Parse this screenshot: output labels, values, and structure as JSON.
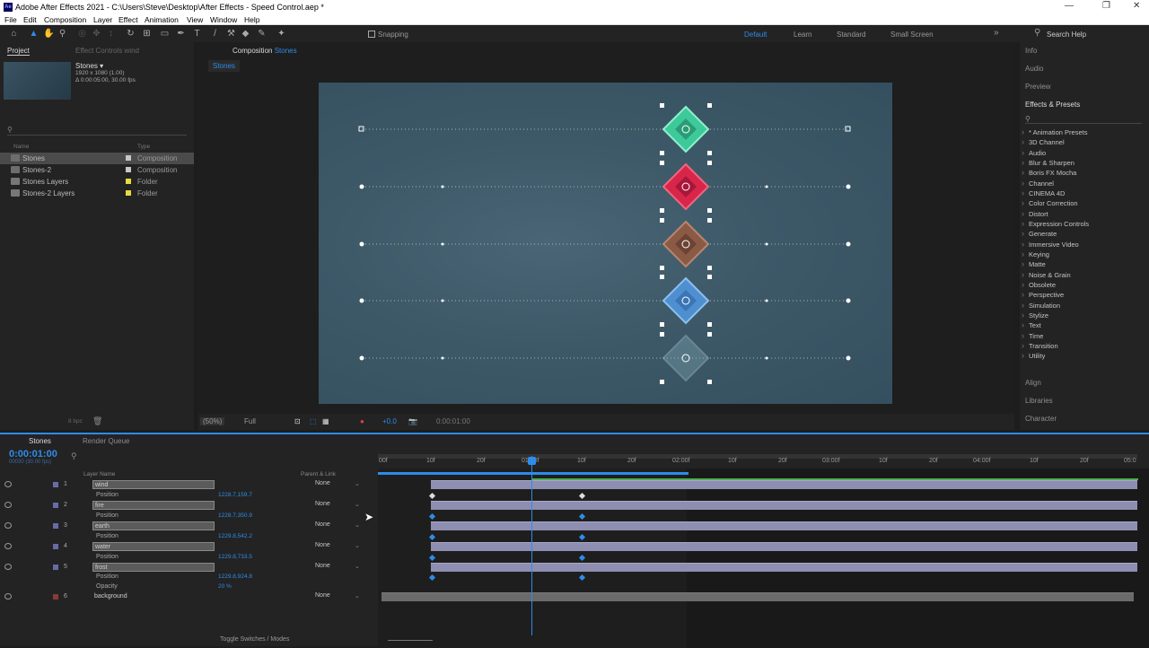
{
  "window": {
    "title": "Adobe After Effects 2021 - C:\\Users\\Steve\\Desktop\\After Effects - Speed Control.aep *",
    "logo": "Ae"
  },
  "menu": [
    "File",
    "Edit",
    "Composition",
    "Layer",
    "Effect",
    "Animation",
    "View",
    "Window",
    "Help"
  ],
  "toolbar": {
    "snapping": "Snapping",
    "workspaces": [
      "Default",
      "Learn",
      "Standard",
      "Small Screen"
    ],
    "search": "Search Help"
  },
  "project": {
    "tab": "Project",
    "effect_controls": "Effect Controls wind",
    "comp_name": "Stones ▾",
    "comp_info1": "1920 x 1080 (1.00)",
    "comp_info2": "Δ 0:00:05:00, 30.00 fps",
    "col_name": "Name",
    "col_type": "Type",
    "items": [
      {
        "name": "Stones",
        "type": "Composition",
        "color": "#c8c8c8"
      },
      {
        "name": "Stones-2",
        "type": "Composition",
        "color": "#c8c8c8"
      },
      {
        "name": "Stones Layers",
        "type": "Folder",
        "color": "#e6dc3c"
      },
      {
        "name": "Stones-2 Layers",
        "type": "Folder",
        "color": "#e6dc3c"
      }
    ],
    "bpc": "8 bpc"
  },
  "composition": {
    "tab_prefix": "Composition",
    "tab_name": "Stones",
    "sub_tab": "Stones",
    "zoom": "(50%)",
    "quality": "Full",
    "exposure": "+0.0",
    "time": "0:00:01:00"
  },
  "right": {
    "info": "Info",
    "audio": "Audio",
    "preview": "Preview",
    "effects_presets": "Effects & Presets",
    "effects": [
      "* Animation Presets",
      "3D Channel",
      "Audio",
      "Blur & Sharpen",
      "Boris FX Mocha",
      "Channel",
      "CINEMA 4D",
      "Color Correction",
      "Distort",
      "Expression Controls",
      "Generate",
      "Immersive Video",
      "Keying",
      "Matte",
      "Noise & Grain",
      "Obsolete",
      "Perspective",
      "Simulation",
      "Stylize",
      "Text",
      "Time",
      "Transition",
      "Utility"
    ],
    "align": "Align",
    "libraries": "Libraries",
    "character": "Character"
  },
  "timeline": {
    "tab": "Stones",
    "render_queue": "Render Queue",
    "timecode": "0:00:01:00",
    "frames": "00030 (30.00 fps)",
    "col_layer": "Layer Name",
    "col_parent": "Parent & Link",
    "toggle": "Toggle Switches / Modes",
    "ruler": [
      "00f",
      "10f",
      "20f",
      "01:00f",
      "10f",
      "20f",
      "02:00f",
      "10f",
      "20f",
      "03:00f",
      "10f",
      "20f",
      "04:00f",
      "10f",
      "20f",
      "05:0"
    ],
    "layers": [
      {
        "num": "1",
        "name": "wind",
        "parent": "None",
        "prop": "Position",
        "val": "1228.7,159.7"
      },
      {
        "num": "2",
        "name": "fire",
        "parent": "None",
        "prop": "Position",
        "val": "1228.7,350.9"
      },
      {
        "num": "3",
        "name": "earth",
        "parent": "None",
        "prop": "Position",
        "val": "1229.8,542.2"
      },
      {
        "num": "4",
        "name": "water",
        "parent": "None",
        "prop": "Position",
        "val": "1229.8,733.5"
      },
      {
        "num": "5",
        "name": "frost",
        "parent": "None",
        "prop": "Position",
        "val": "1229.8,924.8",
        "prop2": "Opacity",
        "val2": "20 %"
      },
      {
        "num": "6",
        "name": "background",
        "parent": "None"
      }
    ]
  },
  "colors": {
    "accent": "#2d8ceb",
    "wind": "#3ec99a",
    "fire": "#d8264a",
    "earth": "#8a5a45",
    "water": "#4f8fd0",
    "frost": "#6a8e9e"
  }
}
